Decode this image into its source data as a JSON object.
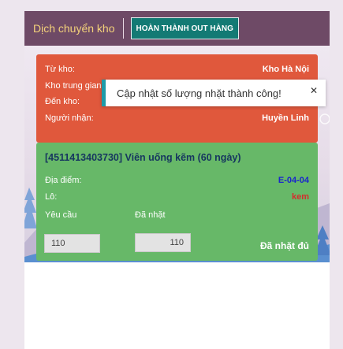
{
  "header": {
    "title": "Dịch chuyển kho",
    "complete_button": "HOÀN THÀNH OUT HÀNG"
  },
  "transfer": {
    "from_label": "Từ kho:",
    "from_value": "Kho Hà Nội",
    "transit_label": "Kho trung gian:",
    "to_label": "Đến kho:",
    "receiver_label": "Người nhận:",
    "receiver_value": "Huyền Linh"
  },
  "item": {
    "title": "[4511413403730] Viên uống kẽm (60 ngày)",
    "location_label": "Địa điểm:",
    "location_value": "E-04-04",
    "lot_label": "Lô:",
    "lot_value": "kem",
    "requested_label": "Yêu cầu",
    "requested_value": "110",
    "picked_label": "Đã nhặt",
    "picked_value": "110",
    "status": "Đã nhặt đủ"
  },
  "toast": {
    "message": "Cập nhật số lượng nhặt thành công!",
    "close_icon": "close-icon"
  },
  "colors": {
    "header_bg": "#6e4a66",
    "header_title": "#f4d27a",
    "button_bg": "#137a74",
    "transfer_card": "#e0583c",
    "item_card": "#67b868",
    "location_text": "#1a26cc",
    "lot_text": "#d52d2d",
    "toast_accent": "#1e9aa8"
  }
}
